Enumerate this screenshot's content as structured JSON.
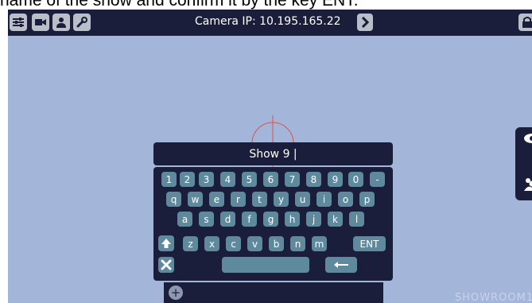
{
  "caption": "name of the show and confirm it by the key ENT.",
  "topbar": {
    "buttons": [
      "settings-sliders-icon",
      "video-camera-icon",
      "user-icon",
      "wrench-icon"
    ],
    "camera_label": "Camera IP: 10.195.165.22",
    "next_icon": "chevron-right-icon",
    "lock_icon": "lock-icon"
  },
  "side_panel": {
    "items": [
      "eye-icon",
      "group-icon"
    ]
  },
  "keyboard": {
    "display_value": "Show 9 |",
    "rows": [
      [
        "1",
        "2",
        "3",
        "4",
        "5",
        "6",
        "7",
        "8",
        "9",
        "0",
        "-"
      ],
      [
        "q",
        "w",
        "e",
        "r",
        "t",
        "y",
        "u",
        "i",
        "o",
        "p"
      ],
      [
        "a",
        "s",
        "d",
        "f",
        "g",
        "h",
        "j",
        "k",
        "l"
      ],
      [
        "z",
        "x",
        "c",
        "v",
        "b",
        "n",
        "m"
      ]
    ],
    "shift_icon": "arrow-up-icon",
    "enter_label": "ENT",
    "close_icon": "close-icon",
    "space_label": "",
    "backspace_icon": "arrow-left-icon"
  },
  "bottom_bar": {
    "add_label": "+"
  },
  "watermark": "SHOWROOM1",
  "colors": {
    "background": "#a3b6da",
    "bar": "#1a1e3a",
    "key": "#5f8a9e",
    "crosshair": "#d9534f"
  }
}
